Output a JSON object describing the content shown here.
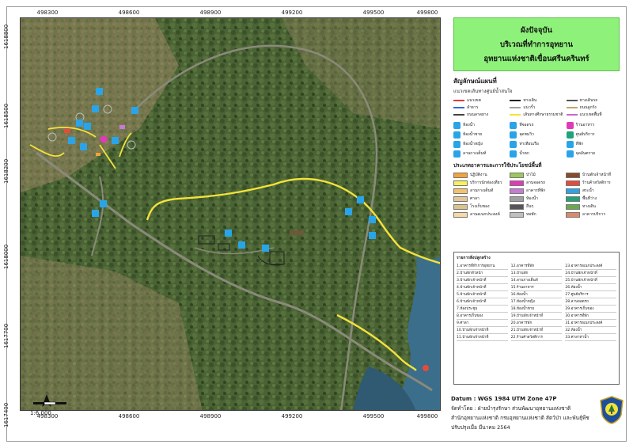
{
  "title": {
    "line1": "ผังปัจจุบัน",
    "line2": "บริเวณที่ทำการอุทยาน",
    "line3": "อุทยานแห่งชาติเขื่อนศรีนครินทร์"
  },
  "axes": {
    "x_ticks": [
      "498300",
      "498600",
      "498900",
      "499200",
      "499500",
      "499800"
    ],
    "y_ticks": [
      "1618800",
      "1618500",
      "1618200",
      "1618000",
      "1617700",
      "1617400"
    ]
  },
  "legend": {
    "heading": "สัญลักษณ์แผนที่",
    "subheading": "แนวเขตเส้นทางศูนย์น้ำสนใจ",
    "lines": [
      {
        "label": "แนวเขต",
        "color": "#e63a3a"
      },
      {
        "label": "ทางเดิน",
        "color": "#222222"
      },
      {
        "label": "ทางเดินรถ",
        "color": "#555555"
      },
      {
        "label": "ลำธาร",
        "color": "#2f6bd6"
      },
      {
        "label": "แนวรั้ว",
        "color": "#a0a0a0"
      },
      {
        "label": "ถนนลูกรัง",
        "color": "#c8a26a"
      },
      {
        "label": "ถนนลาดยาง",
        "color": "#444444"
      },
      {
        "label": "เส้นทางศึกษาธรรมชาติ",
        "color": "#f3e23b"
      },
      {
        "label": "แนวเขตพื้นที่",
        "color": "#cc66cc"
      }
    ],
    "icons": [
      {
        "label": "ห้องน้ำ",
        "color": "#2aa4e8"
      },
      {
        "label": "ที่จอดรถ",
        "color": "#2aa4e8"
      },
      {
        "label": "ร้านอาหาร",
        "color": "#e03ab8"
      },
      {
        "label": "ห้องน้ำชาย",
        "color": "#2aa4e8"
      },
      {
        "label": "จุดชมวิว",
        "color": "#2aa4e8"
      },
      {
        "label": "ศูนย์บริการ",
        "color": "#1ea37a"
      },
      {
        "label": "ห้องน้ำหญิง",
        "color": "#2aa4e8"
      },
      {
        "label": "ท่าเทียบเรือ",
        "color": "#2aa4e8"
      },
      {
        "label": "ที่พัก",
        "color": "#2aa4e8"
      },
      {
        "label": "ลานกางเต็นท์",
        "color": "#2aa4e8"
      },
      {
        "label": "น้ำตก",
        "color": "#2aa4e8"
      },
      {
        "label": "จุดอันตราย",
        "color": "#2aa4e8"
      }
    ],
    "landuse_heading": "ประเภทอาคารและการใช้ประโยชน์พื้นที่",
    "landuse": [
      {
        "label": "ปฏิบัติงาน",
        "color": "#f4a23b"
      },
      {
        "label": "ป่าไม้",
        "color": "#9cc85a"
      },
      {
        "label": "บ้านพักเจ้าหน้าที่",
        "color": "#8a4a2a"
      },
      {
        "label": "บริการนักท่องเที่ยว",
        "color": "#f7f25a"
      },
      {
        "label": "ลานจอดรถ",
        "color": "#e03ab8"
      },
      {
        "label": "ร้านค้าสวัสดิการ",
        "color": "#e84a3a"
      },
      {
        "label": "ลานกางเต็นท์",
        "color": "#f5c26a"
      },
      {
        "label": "อาคารที่พัก",
        "color": "#c87ad6"
      },
      {
        "label": "สระน้ำ",
        "color": "#2aa4e8"
      },
      {
        "label": "ศาลา",
        "color": "#e4c69a"
      },
      {
        "label": "ห้องน้ำ",
        "color": "#a0a0a0"
      },
      {
        "label": "พื้นที่ว่าง",
        "color": "#1ea37a"
      },
      {
        "label": "โรงเก็บของ",
        "color": "#d9c48a"
      },
      {
        "label": "อื่นๆ",
        "color": "#555555"
      },
      {
        "label": "ทางเดิน",
        "color": "#6aa84f"
      },
      {
        "label": "ลานอเนกประสงค์",
        "color": "#f7d9a8"
      },
      {
        "label": "หอพัก",
        "color": "#bfbfbf"
      },
      {
        "label": "อาคารบริการ",
        "color": "#d98a6a"
      }
    ]
  },
  "buildings": {
    "heading": "รายการสิ่งปลูกสร้าง",
    "items": [
      "1.อาคารที่ทำการอุทยาน",
      "12.อาคารที่พัก",
      "23.อาคารอเนกประสงค์",
      "2.บ้านพักหัวหน้า",
      "13.บ้านพัก",
      "24.บ้านพักเจ้าหน้าที่",
      "3.บ้านพักเจ้าหน้าที่",
      "14.ลานกางเต็นท์",
      "25.บ้านพักเจ้าหน้าที่",
      "4.บ้านพักเจ้าหน้าที่",
      "15.ร้านอาหาร",
      "26.ห้องน้ำ",
      "5.บ้านพักเจ้าหน้าที่",
      "16.ห้องน้ำ",
      "27.ศูนย์บริการ",
      "6.บ้านพักเจ้าหน้าที่",
      "17.ห้องน้ำหญิง",
      "28.ลานจอดรถ",
      "7.ห้องประชุม",
      "18.ห้องน้ำชาย",
      "29.อาคารเก็บของ",
      "8.อาคารเก็บของ",
      "19.บ้านพักเจ้าหน้าที่",
      "30.อาคารที่พัก",
      "9.ศาลา",
      "20.อาคารพัก",
      "31.อาคารอเนกประสงค์",
      "10.บ้านพักเจ้าหน้าที่",
      "21.บ้านพักเจ้าหน้าที่",
      "32.ห้องน้ำ",
      "11.บ้านพักเจ้าหน้าที่",
      "22.ร้านค้าสวัสดิการ",
      "33.ศาลาท่าน้ำ"
    ]
  },
  "info": {
    "datum": "Datum   : WGS 1984 UTM Zone 47P",
    "made_by": "จัดทำโดย   : ฝ่ายบำรุงรักษา ส่วนพัฒนาอุทยานแห่งชาติ",
    "agency": "สำนักอุทยานแห่งชาติ  กรมอุทยานแห่งชาติ สัตว์ป่า และพันธุ์พืช",
    "updated": "ปรับปรุงเมื่อ มีนาคม 2564"
  },
  "scale": "1:6,000",
  "colors": {
    "trail": "#f3e23b",
    "road": "#8a8a7a",
    "forest": "#3f5a2e",
    "water": "#3b6e8a",
    "title_bg": "#8ef27a"
  }
}
